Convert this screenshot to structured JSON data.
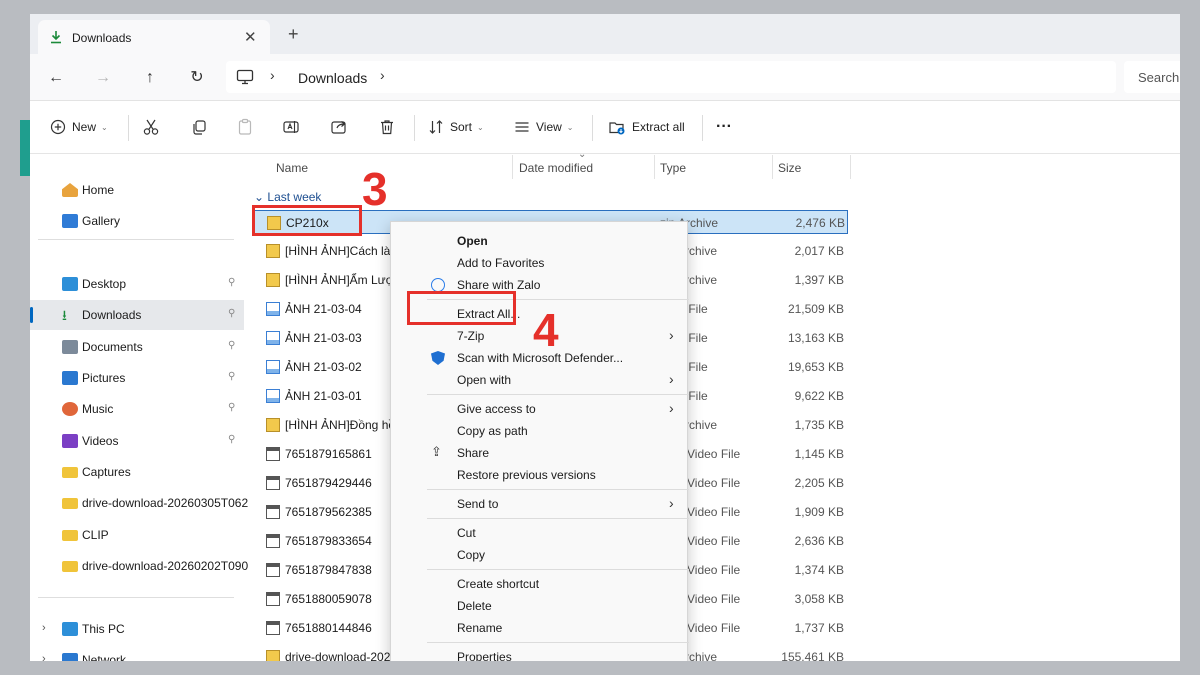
{
  "tab": {
    "title": "Downloads",
    "close_icon": "close-icon",
    "new_tab": "+"
  },
  "nav": {
    "back": "←",
    "forward": "→",
    "up": "↑",
    "refresh": "↻"
  },
  "address": {
    "separator": "›",
    "location": "Downloads",
    "separator_end": "›"
  },
  "search": {
    "placeholder": "Search"
  },
  "toolbar": {
    "new_label": "New",
    "sort_label": "Sort",
    "view_label": "View",
    "extract_label": "Extract all",
    "more_label": "···"
  },
  "sidebar": {
    "items": [
      {
        "label": "Home",
        "icon": "home-icon",
        "color": "#e8a33d",
        "pinned": false,
        "selected": false
      },
      {
        "label": "Gallery",
        "icon": "gallery-icon",
        "color": "#2f7bd6",
        "pinned": false,
        "selected": false
      },
      {
        "label": "Desktop",
        "icon": "desktop-icon",
        "color": "#2d8fd8",
        "pinned": true,
        "selected": false
      },
      {
        "label": "Downloads",
        "icon": "download-icon",
        "color": "#1b8a3a",
        "pinned": true,
        "selected": true
      },
      {
        "label": "Documents",
        "icon": "document-icon",
        "color": "#7c8a9a",
        "pinned": true,
        "selected": false
      },
      {
        "label": "Pictures",
        "icon": "pictures-icon",
        "color": "#2a78d0",
        "pinned": true,
        "selected": false
      },
      {
        "label": "Music",
        "icon": "music-icon",
        "color": "#e0663a",
        "pinned": true,
        "selected": false
      },
      {
        "label": "Videos",
        "icon": "videos-icon",
        "color": "#7b3fc4",
        "pinned": true,
        "selected": false
      },
      {
        "label": "Captures",
        "icon": "folder-icon",
        "color": "#f0c43a",
        "pinned": false,
        "selected": false
      },
      {
        "label": "drive-download-20260305T062",
        "icon": "folder-icon",
        "color": "#f0c43a",
        "pinned": false,
        "selected": false
      },
      {
        "label": "CLIP",
        "icon": "folder-icon",
        "color": "#f0c43a",
        "pinned": false,
        "selected": false
      },
      {
        "label": "drive-download-20260202T090",
        "icon": "folder-icon",
        "color": "#f0c43a",
        "pinned": false,
        "selected": false
      }
    ],
    "this_pc": "This PC",
    "network": "Network",
    "pin_glyph": "📌"
  },
  "columns": {
    "name": "Name",
    "date": "Date modified",
    "type": "Type",
    "size": "Size"
  },
  "group_label": "Last week",
  "files": [
    {
      "name": "CP210x",
      "type": "zip Archive",
      "size": "2,476 KB",
      "kind": "zip",
      "selected": true
    },
    {
      "name": "[HÌNH ẢNH]Cách là",
      "type": "zip Archive",
      "size": "2,017 KB",
      "kind": "zip",
      "selected": false
    },
    {
      "name": "[HÌNH ẢNH]Ẩm Lượ",
      "type": "zip Archive",
      "size": "1,397 KB",
      "kind": "zip",
      "selected": false
    },
    {
      "name": "ẢNH 21-03-04",
      "type": "PNG File",
      "size": "21,509 KB",
      "kind": "png",
      "selected": false
    },
    {
      "name": "ẢNH 21-03-03",
      "type": "PNG File",
      "size": "13,163 KB",
      "kind": "png",
      "selected": false
    },
    {
      "name": "ẢNH 21-03-02",
      "type": "PNG File",
      "size": "19,653 KB",
      "kind": "png",
      "selected": false
    },
    {
      "name": "ẢNH 21-03-01",
      "type": "PNG File",
      "size": "9,622 KB",
      "kind": "png",
      "selected": false
    },
    {
      "name": "[HÌNH ẢNH]Đồng hồ",
      "type": "zip Archive",
      "size": "1,735 KB",
      "kind": "zip",
      "selected": false
    },
    {
      "name": "7651879165861",
      "type": "MP4 Video File",
      "size": "1,145 KB",
      "kind": "mp4",
      "selected": false
    },
    {
      "name": "7651879429446",
      "type": "MP4 Video File",
      "size": "2,205 KB",
      "kind": "mp4",
      "selected": false
    },
    {
      "name": "7651879562385",
      "type": "MP4 Video File",
      "size": "1,909 KB",
      "kind": "mp4",
      "selected": false
    },
    {
      "name": "7651879833654",
      "type": "MP4 Video File",
      "size": "2,636 KB",
      "kind": "mp4",
      "selected": false
    },
    {
      "name": "7651879847838",
      "type": "MP4 Video File",
      "size": "1,374 KB",
      "kind": "mp4",
      "selected": false
    },
    {
      "name": "7651880059078",
      "type": "MP4 Video File",
      "size": "3,058 KB",
      "kind": "mp4",
      "selected": false
    },
    {
      "name": "7651880144846",
      "type": "MP4 Video File",
      "size": "1,737 KB",
      "kind": "mp4",
      "selected": false
    },
    {
      "name": "drive-download-202",
      "type": "zip Archive",
      "size": "155,461 KB",
      "kind": "zip",
      "selected": false
    }
  ],
  "context_menu": [
    {
      "label": "Open",
      "bold": true,
      "icon": "",
      "submenu": false
    },
    {
      "label": "Add to Favorites",
      "bold": false,
      "icon": "",
      "submenu": false
    },
    {
      "label": "Share with Zalo",
      "bold": false,
      "icon": "zalo-icon",
      "submenu": false
    },
    {
      "sep": true
    },
    {
      "label": "Extract All...",
      "bold": false,
      "icon": "",
      "submenu": false
    },
    {
      "label": "7-Zip",
      "bold": false,
      "icon": "",
      "submenu": true
    },
    {
      "label": "Scan with Microsoft Defender...",
      "bold": false,
      "icon": "defender-shield-icon",
      "submenu": false
    },
    {
      "label": "Open with",
      "bold": false,
      "icon": "",
      "submenu": true
    },
    {
      "sep": true
    },
    {
      "label": "Give access to",
      "bold": false,
      "icon": "",
      "submenu": true
    },
    {
      "label": "Copy as path",
      "bold": false,
      "icon": "",
      "submenu": false
    },
    {
      "label": "Share",
      "bold": false,
      "icon": "share-icon",
      "submenu": false
    },
    {
      "label": "Restore previous versions",
      "bold": false,
      "icon": "",
      "submenu": false
    },
    {
      "sep": true
    },
    {
      "label": "Send to",
      "bold": false,
      "icon": "",
      "submenu": true
    },
    {
      "sep": true
    },
    {
      "label": "Cut",
      "bold": false,
      "icon": "",
      "submenu": false
    },
    {
      "label": "Copy",
      "bold": false,
      "icon": "",
      "submenu": false
    },
    {
      "sep": true
    },
    {
      "label": "Create shortcut",
      "bold": false,
      "icon": "",
      "submenu": false
    },
    {
      "label": "Delete",
      "bold": false,
      "icon": "",
      "submenu": false
    },
    {
      "label": "Rename",
      "bold": false,
      "icon": "",
      "submenu": false
    },
    {
      "sep": true
    },
    {
      "label": "Properties",
      "bold": false,
      "icon": "",
      "submenu": false
    }
  ],
  "annotations": {
    "step3": "3",
    "step4": "4",
    "color": "#e5302a"
  },
  "accent": "#0067c0"
}
